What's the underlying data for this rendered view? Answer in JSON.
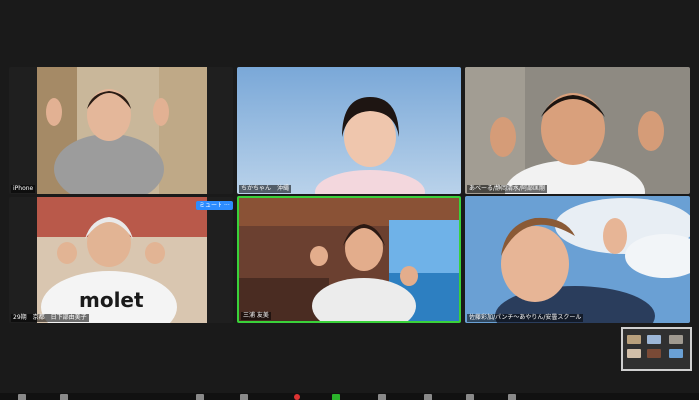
{
  "participants": [
    {
      "name": "iPhone"
    },
    {
      "name": "ちかちゃん　沖縄"
    },
    {
      "name": "あべーる/静岡清水/阿部匡剛"
    },
    {
      "name": "29期　京都　日下部由美子"
    },
    {
      "name": "三浦 友美"
    },
    {
      "name": "佐藤彩加/パンチ〜あやりん/安曇スクール"
    }
  ],
  "hover_controls": {
    "mute_label": "ミュート",
    "more_label": "···"
  },
  "colors": {
    "active_speaker": "#3ad13a",
    "button_blue": "#2d8cff",
    "record_red": "#dd3333",
    "share_green": "#2bb32b"
  }
}
